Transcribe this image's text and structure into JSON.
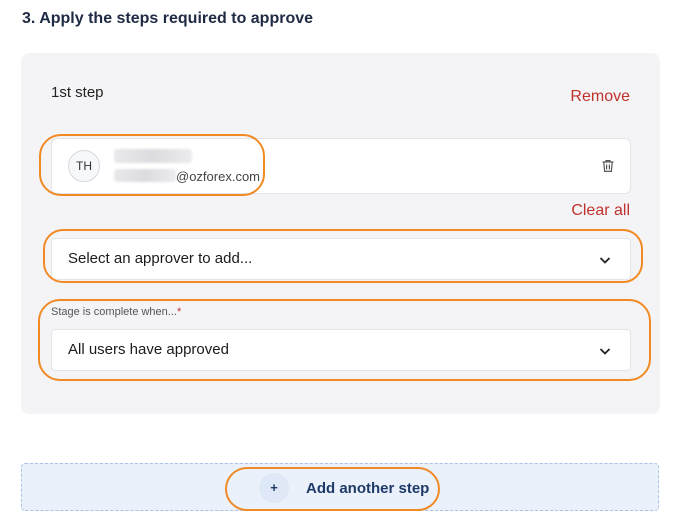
{
  "section": {
    "heading": "3. Apply the steps required to approve"
  },
  "step": {
    "title": "1st step",
    "remove_label": "Remove",
    "approver": {
      "initials": "TH",
      "email_domain": "@ozforex.com"
    },
    "clear_all_label": "Clear all",
    "approver_select": {
      "placeholder": "Select an approver to add..."
    },
    "stage": {
      "label": "Stage is complete when...",
      "required_mark": "*",
      "value": "All users have approved"
    }
  },
  "add_step": {
    "plus": "+",
    "label": "Add another step"
  },
  "colors": {
    "accent_red": "#c0312b",
    "highlight_orange": "#f08a24",
    "primary_navy": "#1f3a68"
  },
  "icons": {
    "trash": "trash-icon",
    "dropdown": "chevron-down-icon",
    "add": "plus-icon"
  }
}
